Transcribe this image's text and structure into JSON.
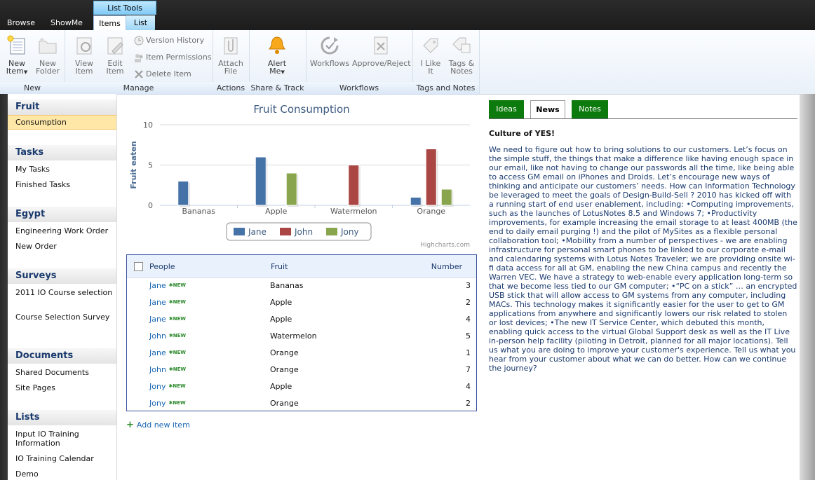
{
  "top_tabs": {
    "browse": "Browse",
    "showme": "ShowMe",
    "items": "Items",
    "list": "List",
    "list_tools": "List Tools"
  },
  "ribbon": {
    "new_item": "New",
    "new_item2": "Item",
    "new_folder": "New",
    "new_folder2": "Folder",
    "view_item": "View",
    "view_item2": "Item",
    "edit_item": "Edit",
    "edit_item2": "Item",
    "version_history": "Version History",
    "item_permissions": "Item Permissions",
    "delete_item": "Delete Item",
    "attach_file": "Attach",
    "attach_file2": "File",
    "alert_me": "Alert",
    "alert_me2": "Me",
    "workflows": "Workflows",
    "approve_reject": "Approve/Reject",
    "i_like_it": "I Like",
    "i_like_it2": "It",
    "tags_notes": "Tags &",
    "tags_notes2": "Notes",
    "groups": {
      "new": "New",
      "manage": "Manage",
      "actions": "Actions",
      "share_track": "Share & Track",
      "workflows": "Workflows",
      "tags_notes": "Tags and Notes"
    }
  },
  "sidebar": {
    "fruit": "Fruit",
    "consumption": "Consumption",
    "tasks": "Tasks",
    "my_tasks": "My Tasks",
    "finished_tasks": "Finished Tasks",
    "egypt": "Egypt",
    "engineering_work_order": "Engineering Work Order",
    "new_order": "New Order",
    "surveys": "Surveys",
    "io_course": "2011 IO Course selection",
    "course_survey": "Course Selection Survey",
    "documents": "Documents",
    "shared_documents": "Shared Documents",
    "site_pages": "Site Pages",
    "lists": "Lists",
    "input_io": "Input IO Training Information",
    "io_calendar": "IO Training Calendar",
    "demo": "Demo"
  },
  "chart_data": {
    "type": "bar",
    "title": "Fruit Consumption",
    "xlabel": "",
    "ylabel": "Fruit eaten",
    "categories": [
      "Bananas",
      "Apple",
      "Watermelon",
      "Orange"
    ],
    "ylim": [
      0,
      10
    ],
    "yticks": [
      0,
      5,
      10
    ],
    "series": [
      {
        "name": "Jane",
        "color": "#4572a7",
        "values": [
          3,
          6,
          0,
          1
        ]
      },
      {
        "name": "John",
        "color": "#aa4643",
        "values": [
          0,
          0,
          5,
          7
        ]
      },
      {
        "name": "Jony",
        "color": "#89a54e",
        "values": [
          0,
          4,
          0,
          2
        ]
      }
    ],
    "legend": "bottom-center",
    "credits": "Highcharts.com"
  },
  "list": {
    "headers": {
      "people": "People",
      "fruit": "Fruit",
      "number": "Number"
    },
    "new_tag": "NEW",
    "rows": [
      {
        "person": "Jane",
        "fruit": "Bananas",
        "number": "3"
      },
      {
        "person": "Jane",
        "fruit": "Apple",
        "number": "2"
      },
      {
        "person": "Jane",
        "fruit": "Apple",
        "number": "4"
      },
      {
        "person": "John",
        "fruit": "Watermelon",
        "number": "5"
      },
      {
        "person": "Jane",
        "fruit": "Orange",
        "number": "1"
      },
      {
        "person": "John",
        "fruit": "Orange",
        "number": "7"
      },
      {
        "person": "Jony",
        "fruit": "Apple",
        "number": "4"
      },
      {
        "person": "Jony",
        "fruit": "Orange",
        "number": "2"
      }
    ],
    "add_new": "Add new item"
  },
  "right_tabs": {
    "ideas": "Ideas",
    "news": "News",
    "notes": "Notes"
  },
  "news": {
    "title": "Culture of YES!",
    "body": "We need to figure out how to bring solutions to our customers. Let’s focus on the simple stuff, the things that make a difference like having enough space in our email, like not having to change our passwords all the time, like being able to access GM email on iPhones and Droids. Let’s encourage new ways of thinking and anticipate our customers’ needs. How can Information Technology be leveraged to meet the goals of Design-Build-Sell ? 2010 has kicked off with a running start of end user enablement, including: •Computing improvements, such as the launches of LotusNotes 8.5 and Windows 7; •Productivity improvements, for example increasing the email storage to at least 400MB (the end to daily email purging !) and the pilot of MySites as a flexible personal collaboration tool; •Mobility from a number of perspectives - we are enabling infrastructure for personal smart phones to be linked to our corporate e-mail and calendaring systems with Lotus Notes Traveler; we are providing onsite wi-fi data access for all at GM, enabling the new China campus and recently the Warren VEC. We have a strategy to web-enable every application long-term so that we become less tied to our GM computer; •“PC on a stick” … an encrypted USB stick that will allow access to GM systems from any computer, including MACs. This technology makes it significantly easier for the user to get to GM applications from anywhere and significantly lowers our risk related to stolen or lost devices; •The new IT Service Center, which debuted this month, enabling quick access to the virtual Global Support desk as well as the IT Live in-person help facility (piloting in Detroit, planned for all major locations). Tell us what you are doing to improve your customer's experience. Tell us what you hear from your customer about what we can do better. How can we continue the journey?"
  }
}
